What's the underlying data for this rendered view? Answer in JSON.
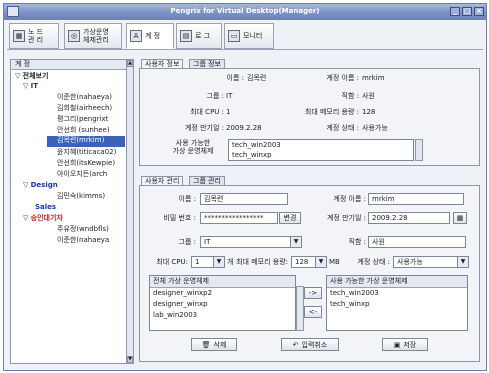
{
  "window": {
    "title": "Pengrix for Virtual Desktop(Manager)"
  },
  "toolbar": {
    "tabs": [
      {
        "label": "노 드\n관 리",
        "icon": "node-icon"
      },
      {
        "label": "가상운영\n체제관리",
        "icon": "vm-icon"
      },
      {
        "label": "계 정",
        "icon": "account-icon"
      },
      {
        "label": "로 그",
        "icon": "log-icon"
      },
      {
        "label": "모니터",
        "icon": "monitor-icon"
      }
    ],
    "active_tab": "계 정"
  },
  "tree": {
    "header": "계 정",
    "root": "전체보기",
    "groups": [
      {
        "name": "IT",
        "color": "#1a35b8",
        "users": [
          "이준한(nahaeya)",
          "김희철(airheech)",
          "평그리(pengrixt",
          "안선희 (sunhee)",
          "김목련(mrkim)",
          "윤지혜(titicaca02)",
          "안선희(itsKewpie)",
          "아이오지든(arch"
        ]
      },
      {
        "name": "Design",
        "color": "#1a35b8",
        "users": [
          "김민숙(kimms)"
        ]
      },
      {
        "name": "Sales",
        "color": "#1a35b8",
        "users": []
      },
      {
        "name": "승인대기자",
        "color": "#d11a1a",
        "users": [
          "주유정(wndbfls)",
          "이준한(nahaeya"
        ]
      }
    ],
    "selected_user": "김목련(mrkim)"
  },
  "user_info": {
    "tabs": [
      "사용자 정보",
      "그룹 정보"
    ],
    "name_label": "이름 :",
    "name": "김목련",
    "account_label": "계정 이름 :",
    "account": "mrkim",
    "group_label": "그룹 :",
    "group": "IT",
    "position_label": "직함 :",
    "position": "사원",
    "cpu_label": "최대 CPU :",
    "cpu": "1",
    "mem_label": "최대 메모리 용량 :",
    "mem": "128",
    "expire_label": "계정 만기일 :",
    "expire": "2009.2.28",
    "status_label": "계정 상태 :",
    "status": "사용가능",
    "os_label": "사용 가능한\n가상 운영체제",
    "os_list": [
      "tech_win2003",
      "tech_winxp"
    ]
  },
  "user_mgmt": {
    "tabs": [
      "사용자 관리",
      "그룹 관리"
    ],
    "name_label": "이름 :",
    "name": "김목련",
    "account_label": "계정 이름 :",
    "account": "mrkim",
    "password_label": "비밀 번호 :",
    "password": "*****************",
    "change_button": "변경",
    "expire_label": "계정 만기일 :",
    "expire": "2009.2.28",
    "group_label": "그룹 :",
    "group": "IT",
    "position_label": "직함 :",
    "position": "사원",
    "cpu_label": "최대 CPU:",
    "cpu": "1",
    "cpu_unit": "개",
    "mem_label": "최대 메모리 용량:",
    "mem": "128",
    "mem_unit": "MB",
    "status_label": "계정 상태 :",
    "status": "사용가능",
    "all_os_header": "전체 가상 운영체제",
    "all_os": [
      "designer_winxp2",
      "designer_winxp",
      "lab_win2003"
    ],
    "avail_os_header": "사용 가능한 가상 운영체제",
    "avail_os": [
      "tech_win2003",
      "tech_winxp"
    ],
    "add_button": "->",
    "remove_button": "<-",
    "delete_button": "삭제",
    "cancel_button": "입력취소",
    "save_button": "저장"
  }
}
